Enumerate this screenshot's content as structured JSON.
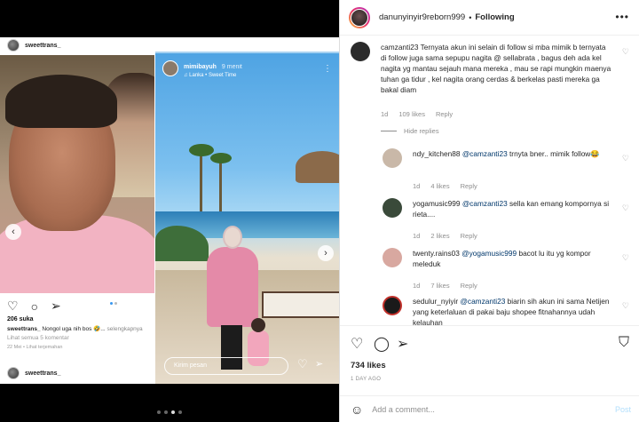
{
  "media": {
    "embedded_post": {
      "username": "sweettrans_",
      "likes": "206 suka",
      "caption_user": "sweettrans_",
      "caption_text": "Nongol uga nih bos 🤣...",
      "caption_more": "selengkapnya",
      "view_all": "Lihat semua 5 komentar",
      "time": "22 Mei • Lihat terjemahan",
      "footer_username": "sweettrans_"
    },
    "embedded_story": {
      "username": "mimibayuh",
      "time": "9 menit",
      "music": "♫ Lanka • Sweet Time",
      "reply_placeholder": "Kirim pesan"
    }
  },
  "panel": {
    "header": {
      "username": "danunyinyir9reborn999",
      "separator": "•",
      "follow_status": "Following",
      "more_icon": "more-horizontal-icon"
    },
    "comments": [
      {
        "username": "camzanti23",
        "text": "Ternyata akun ini selain di follow si mba mimik b ternyata di follow juga sama sepupu nagita @ sellabrata , bagus deh ada kel nagita yg mantau sejauh mana mereka , mau se rapi mungkin maenya tuhan ga tidur , kel nagita orang cerdas & berkelas pasti mereka ga bakal diam",
        "age": "1d",
        "likes": "109 likes",
        "reply": "Reply",
        "avatar_color": "#2b2b2b"
      }
    ],
    "hide_replies": "Hide replies",
    "replies": [
      {
        "username": "ndy_kitchen88",
        "mention": "@camzanti23",
        "text": "trnyta bner.. mimik follow😂",
        "age": "1d",
        "likes": "4 likes",
        "reply": "Reply",
        "avatar_color": "#c9b8a8"
      },
      {
        "username": "yogamusic999",
        "mention": "@camzanti23",
        "text": "sella kan emang kompornya si rieta....",
        "age": "1d",
        "likes": "2 likes",
        "reply": "Reply",
        "avatar_color": "#3a4a3a"
      },
      {
        "username": "twenty.rains03",
        "mention": "@yogamusic999",
        "text": "bacot lu itu yg kompor meleduk",
        "age": "1d",
        "likes": "7 likes",
        "reply": "Reply",
        "avatar_color": "#d8a8a0"
      },
      {
        "username": "sedulur_nyiyir",
        "mention": "@camzanti23",
        "text": "biarin sih akun ini sama Netijen yang keterlaluan di pakai baju shopee fitnahannya udah kelauhan",
        "age": "",
        "likes": "",
        "reply": "",
        "avatar_color": "#1a1a1a"
      }
    ],
    "likes": "734 likes",
    "date": "1 DAY AGO",
    "add_comment_placeholder": "Add a comment...",
    "post_label": "Post"
  }
}
